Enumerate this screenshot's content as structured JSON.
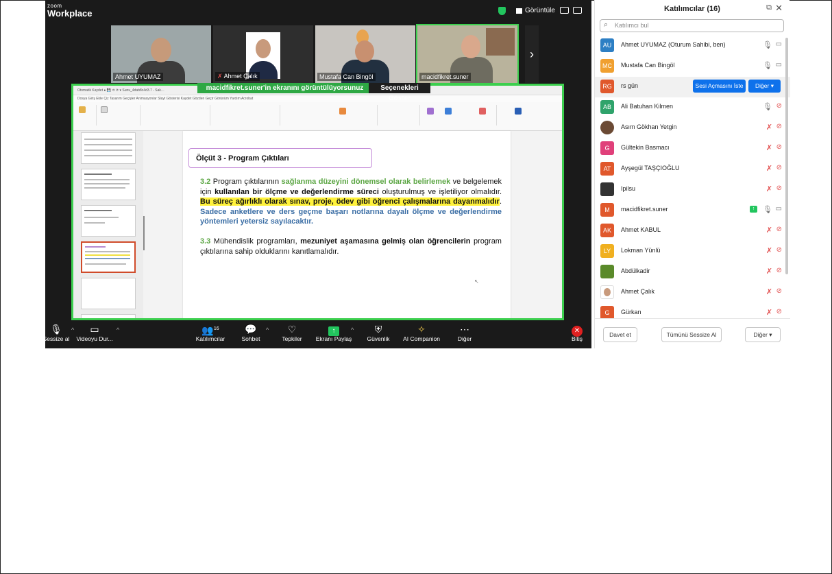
{
  "zoom": {
    "logo_small": "zoom",
    "logo_big": "Workplace",
    "view_label": "Görüntüle",
    "videos": [
      {
        "name": "Ahmet UYUMAZ"
      },
      {
        "name": "Ahmet Çalık"
      },
      {
        "name": "Mustafa Can Bingöl"
      },
      {
        "name": "macidfikret.suner"
      }
    ],
    "next_arrow": "›",
    "share_banner": "macidfikret.suner'in ekranını görüntülüyorsunuz",
    "share_options": "Seçenekleri Göster",
    "ppt": {
      "title_bar": "Otomatik Kaydet  ●   💾  ⟲  ⟳  ▾    Sunu_4dab8c4d3.7 - Sak…",
      "menu": "Dosya   Giriş   Ekle   Çiz   Tasarım   Geçişler   Animasyonlar   Slayt Gösterisi   Kaydet   Gözden Geçir   Görünüm   Yardım   Acrobat",
      "slide": {
        "criterion": "Ölçüt 3 - Program Çıktıları",
        "p1_num": "3.2",
        "p1_a": " Program çıktılarının ",
        "p1_green": "sağlanma düzeyini dönemsel olarak belirlemek",
        "p1_b": " ve belgelemek için ",
        "p1_bold": "kullanılan bir ölçme ve değerlendirme süreci",
        "p1_c": " oluşturulmuş ve işletiliyor olmalıdır.  ",
        "p1_hl": "Bu süreç ağırlıklı olarak sınav, proje, ödev gibi öğrenci çalışmalarına dayanmalıdır",
        "p1_d": ". ",
        "p1_blue": "Sadece anketlere ve ders geçme başarı notlarına dayalı ölçme ve değerlendirme yöntemleri yetersiz sayılacaktır.",
        "p2_num": "3.3",
        "p2_a": " Mühendislik programları, ",
        "p2_bold": "mezuniyet aşamasına gelmiş olan öğrencilerin",
        "p2_b": " program çıktılarına sahip olduklarını kanıtlamalıdır."
      }
    },
    "toolbar": {
      "mute": "Sessize al",
      "video": "Videoyu Dur...",
      "participants": "Katılımcılar",
      "participants_count": "16",
      "chat": "Sohbet",
      "reactions": "Tepkiler",
      "share": "Ekranı Paylaş",
      "security": "Güvenlik",
      "ai": "AI Companion",
      "more": "Diğer",
      "end": "Bitiş"
    }
  },
  "panel": {
    "title": "Katılımcılar (16)",
    "search_placeholder": "Katılımcı bul",
    "participants": [
      {
        "initials": "AU",
        "name": "Ahmet UYUMAZ (Oturum Sahibi, ben)",
        "color": "#2d7fc4"
      },
      {
        "initials": "MC",
        "name": "Mustafa Can Bingöl",
        "color": "#f0a030"
      },
      {
        "initials": "RG",
        "name": "rs gün",
        "color": "#e0582c"
      },
      {
        "initials": "AB",
        "name": "Ali Batuhan Kilmen",
        "color": "#2fa36b"
      },
      {
        "initials": "",
        "name": "Asım Gökhan Yetgin",
        "color": "#6b4a34"
      },
      {
        "initials": "G",
        "name": "Gültekin Basmacı",
        "color": "#e0407a"
      },
      {
        "initials": "AT",
        "name": "Ayşegül TAŞÇIOĞLU",
        "color": "#e0582c"
      },
      {
        "initials": "",
        "name": "Ipilsu",
        "color": "#333333"
      },
      {
        "initials": "M",
        "name": "macidfikret.suner",
        "color": "#e0582c"
      },
      {
        "initials": "AK",
        "name": "Ahmet KABUL",
        "color": "#e0582c"
      },
      {
        "initials": "LY",
        "name": "Lokman Yünlü",
        "color": "#f0b020"
      },
      {
        "initials": "",
        "name": "Abdülkadir",
        "color": "#5a8a2a"
      },
      {
        "initials": "",
        "name": "Ahmet Çalık",
        "color": "#777777"
      },
      {
        "initials": "G",
        "name": "Gürkan",
        "color": "#e0582c"
      }
    ],
    "unmute_request": "Sesi Açmasını İste",
    "more": "Diğer ▾",
    "invite": "Davet et",
    "mute_all": "Tümünü Sessize Al",
    "footer_more": "Diğer ▾"
  },
  "colors": {
    "accent": "#0e71eb",
    "share_green": "#2ea844",
    "muted_red": "#e25050"
  }
}
